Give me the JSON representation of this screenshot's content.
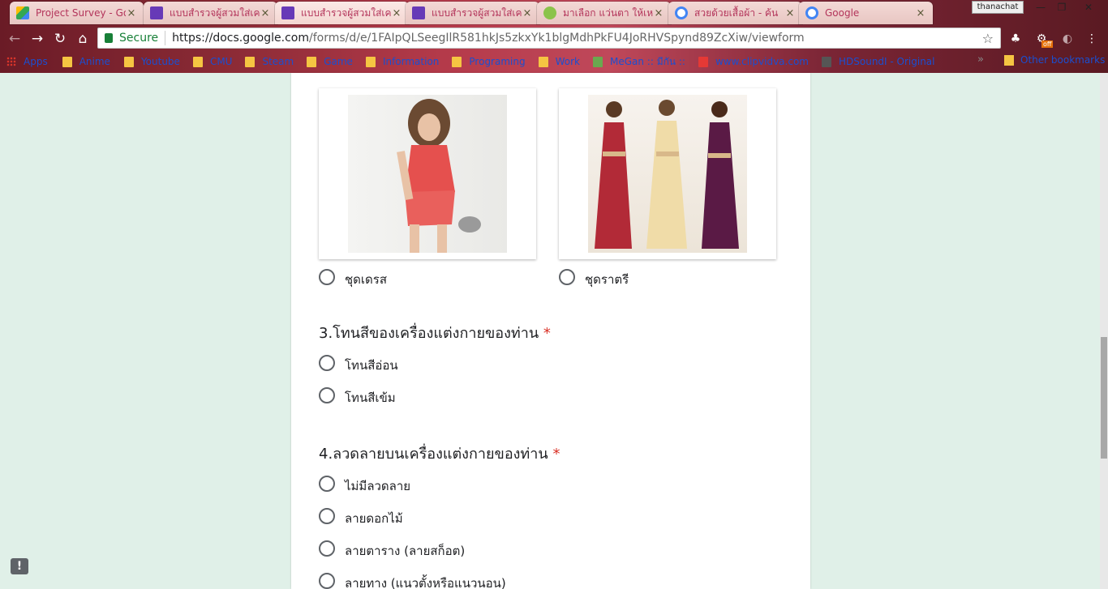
{
  "browser": {
    "tabs": [
      {
        "title": "Project Survey - Go",
        "icon_color": "#fbbc04"
      },
      {
        "title": "แบบสำรวจผู้สวมใส่เครื่",
        "icon_color": "#673ab7"
      },
      {
        "title": "แบบสำรวจผู้สวมใส่เครื่",
        "icon_color": "#673ab7"
      },
      {
        "title": "แบบสำรวจผู้สวมใส่เครื่",
        "icon_color": "#673ab7"
      },
      {
        "title": "มาเลือก แว่นตา ให้เหม",
        "icon_color": "#8bc34a"
      },
      {
        "title": "สวยด้วยเสื้อผ้า - ค้น",
        "icon_color": "#4285f4"
      },
      {
        "title": "Google",
        "icon_color": "#4285f4"
      }
    ],
    "tab_close": "×",
    "user": "thanachat",
    "window": {
      "minimize": "—",
      "restore": "❐",
      "close": "✕"
    },
    "secure_label": "Secure",
    "url_host": "https://docs.google.com",
    "url_path": "/forms/d/e/1FAIpQLSeegIlR581hkJs5zkxYk1blgMdhPkFU4JoRHVSpynd89ZcXiw/viewform",
    "ext_badge": "off",
    "bookmarks": [
      {
        "label": "Apps",
        "type": "apps"
      },
      {
        "label": "Anime",
        "type": "folder"
      },
      {
        "label": "Youtube",
        "type": "folder"
      },
      {
        "label": "CMU",
        "type": "folder"
      },
      {
        "label": "Steam",
        "type": "folder"
      },
      {
        "label": "Game",
        "type": "folder"
      },
      {
        "label": "Information",
        "type": "folder"
      },
      {
        "label": "Programing",
        "type": "folder"
      },
      {
        "label": "Work",
        "type": "folder"
      },
      {
        "label": "MeGan :: มีกัน ::",
        "type": "site"
      },
      {
        "label": "www.clipvidva.com",
        "type": "site"
      },
      {
        "label": "HDSoundI - Original",
        "type": "site"
      }
    ],
    "bookmarks_more": "»",
    "other_bookmarks": "Other bookmarks"
  },
  "form": {
    "image_options": [
      {
        "label": "ชุดเดรส"
      },
      {
        "label": "ชุดราตรี"
      }
    ],
    "questions": [
      {
        "title": "3.โทนสีของเครื่องแต่งกายของท่าน",
        "required_mark": "*",
        "options": [
          "โทนสีอ่อน",
          "โทนสีเข้ม"
        ]
      },
      {
        "title": "4.ลวดลายบนเครื่องแต่งกายของท่าน",
        "required_mark": "*",
        "options": [
          "ไม่มีลวดลาย",
          "ลายดอกไม้",
          "ลายตาราง (ลายสก็อต)",
          "ลายทาง (แนวตั้งหรือแนวนอน)"
        ]
      }
    ]
  },
  "feedback_icon": "!"
}
